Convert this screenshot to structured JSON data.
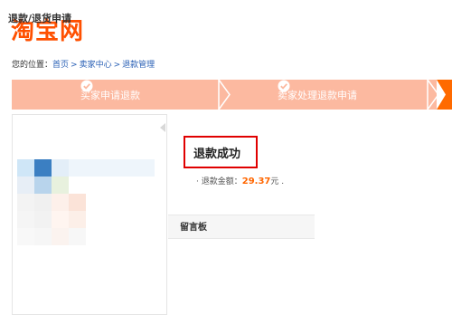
{
  "logo": {
    "text": "淘宝网",
    "color": "#ff5000"
  },
  "breadcrumb": {
    "prefix": "您的位置：",
    "items": [
      "首页",
      "卖家中心",
      "退款管理"
    ],
    "separator": ">"
  },
  "steps": {
    "items": [
      {
        "label": "买家申请退款",
        "icon": "check-circle-icon"
      },
      {
        "label": "卖家处理退款申请",
        "icon": "check-circle-icon"
      }
    ],
    "fill_color": "#fcb9a0",
    "active_color": "#ff6a00"
  },
  "left_panel": {
    "title": "退款/退货申请"
  },
  "result": {
    "title": "退款成功",
    "amount_label": "· 退款金额：",
    "amount": "29.37",
    "unit": "元 ."
  },
  "message_board": {
    "label": "留言板"
  }
}
